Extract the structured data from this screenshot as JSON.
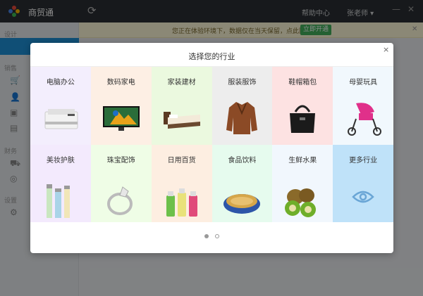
{
  "app": {
    "title": "商贸通"
  },
  "titlebar": {
    "help": "帮助中心",
    "user": "张老师 ▾",
    "minimize": "—",
    "close": "✕"
  },
  "sidebar": {
    "sections": [
      "设计",
      "销售",
      "财务",
      "设置"
    ]
  },
  "notice": {
    "text": "您正在体验环境下，数据仅在当天保留，点此同步免费",
    "button": "立即开通",
    "close": "✕"
  },
  "modal": {
    "title": "选择您的行业",
    "close": "×",
    "industries": [
      {
        "label": "电脑办公",
        "bg": "#f3eefd",
        "icon": "printer-icon"
      },
      {
        "label": "数码家电",
        "bg": "#fdefe4",
        "icon": "tv-icon"
      },
      {
        "label": "家装建材",
        "bg": "#ebf9df",
        "icon": "bed-icon"
      },
      {
        "label": "服装服饰",
        "bg": "#ededed",
        "icon": "coat-icon"
      },
      {
        "label": "鞋帽箱包",
        "bg": "#fde2e2",
        "icon": "handbag-icon"
      },
      {
        "label": "母婴玩具",
        "bg": "#f1f8fd",
        "icon": "stroller-icon"
      },
      {
        "label": "美妆护肤",
        "bg": "#f3eafd",
        "icon": "cosmetics-icon"
      },
      {
        "label": "珠宝配饰",
        "bg": "#effde6",
        "icon": "ring-icon"
      },
      {
        "label": "日用百货",
        "bg": "#fdeee1",
        "icon": "bottles-icon"
      },
      {
        "label": "食品饮料",
        "bg": "#e6fbee",
        "icon": "food-tin-icon"
      },
      {
        "label": "生鲜水果",
        "bg": "#f1f7fd",
        "icon": "kiwi-icon"
      },
      {
        "label": "更多行业",
        "bg": "#bfe2f9",
        "icon": "eye-icon"
      }
    ],
    "pagination": {
      "pages": 2,
      "current": 1
    }
  }
}
